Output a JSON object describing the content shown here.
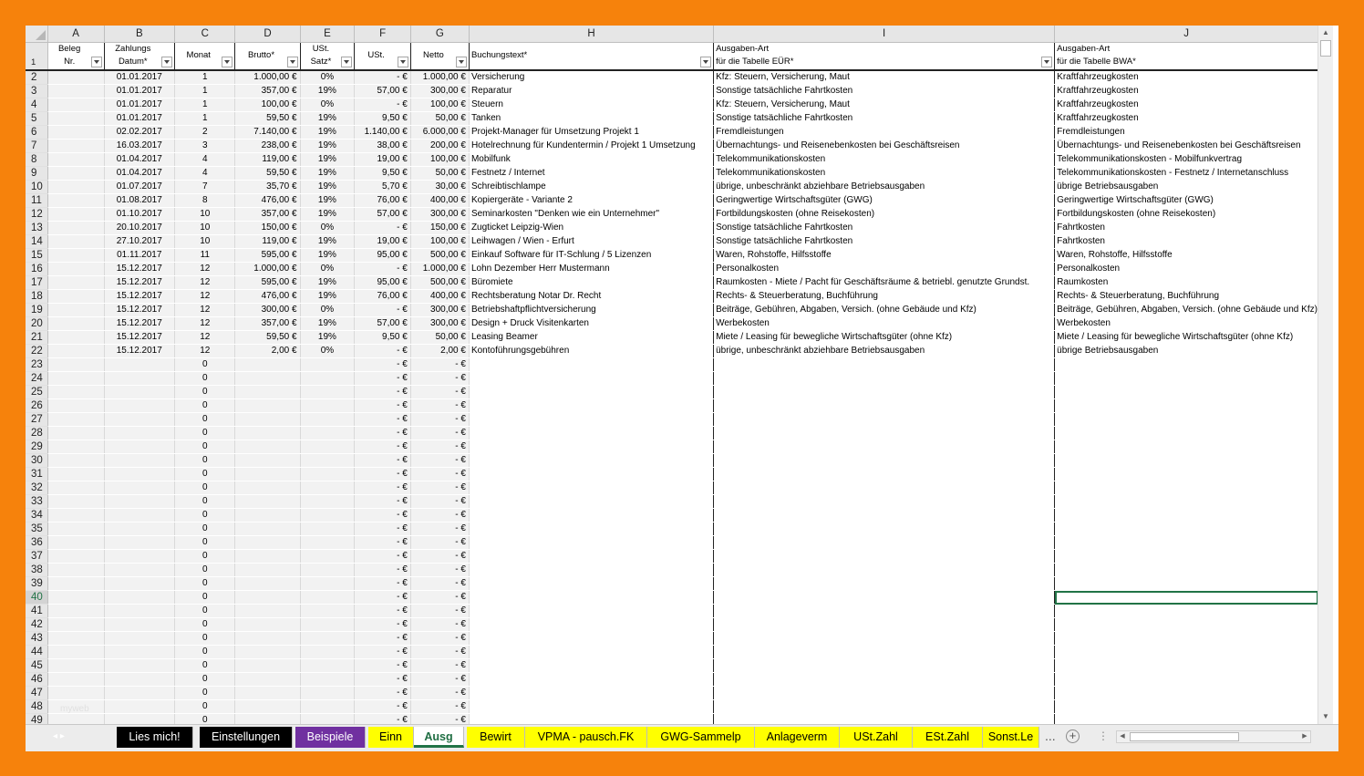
{
  "columns": [
    "A",
    "B",
    "C",
    "D",
    "E",
    "F",
    "G",
    "H",
    "I",
    "J"
  ],
  "headers": {
    "A": [
      "Beleg",
      "Nr."
    ],
    "B": [
      "Zahlungs",
      "Datum*"
    ],
    "C": [
      "Monat"
    ],
    "D": [
      "Brutto*"
    ],
    "E": [
      "USt.",
      "Satz*"
    ],
    "F": [
      "USt."
    ],
    "G": [
      "Netto"
    ],
    "H": [
      "Buchungstext*"
    ],
    "I": [
      "Ausgaben-Art",
      "für die Tabelle EÜR*"
    ],
    "J": [
      "Ausgaben-Art",
      "für die Tabelle BWA*"
    ]
  },
  "rows": [
    {
      "n": "2",
      "A": "",
      "B": "01.01.2017",
      "C": "1",
      "D": "1.000,00 €",
      "E": "0%",
      "F": "-   €",
      "G": "1.000,00 €",
      "H": "Versicherung",
      "I": "Kfz: Steuern, Versicherung, Maut",
      "J": "Kraftfahrzeugkosten"
    },
    {
      "n": "3",
      "A": "",
      "B": "01.01.2017",
      "C": "1",
      "D": "357,00 €",
      "E": "19%",
      "F": "57,00 €",
      "G": "300,00 €",
      "H": "Reparatur",
      "I": "Sonstige tatsächliche Fahrtkosten",
      "J": "Kraftfahrzeugkosten"
    },
    {
      "n": "4",
      "A": "",
      "B": "01.01.2017",
      "C": "1",
      "D": "100,00 €",
      "E": "0%",
      "F": "-   €",
      "G": "100,00 €",
      "H": "Steuern",
      "I": "Kfz: Steuern, Versicherung, Maut",
      "J": "Kraftfahrzeugkosten"
    },
    {
      "n": "5",
      "A": "",
      "B": "01.01.2017",
      "C": "1",
      "D": "59,50 €",
      "E": "19%",
      "F": "9,50 €",
      "G": "50,00 €",
      "H": "Tanken",
      "I": "Sonstige tatsächliche Fahrtkosten",
      "J": "Kraftfahrzeugkosten"
    },
    {
      "n": "6",
      "A": "",
      "B": "02.02.2017",
      "C": "2",
      "D": "7.140,00 €",
      "E": "19%",
      "F": "1.140,00 €",
      "G": "6.000,00 €",
      "H": "Projekt-Manager für Umsetzung Projekt 1",
      "I": "Fremdleistungen",
      "J": "Fremdleistungen"
    },
    {
      "n": "7",
      "A": "",
      "B": "16.03.2017",
      "C": "3",
      "D": "238,00 €",
      "E": "19%",
      "F": "38,00 €",
      "G": "200,00 €",
      "H": "Hotelrechnung für Kundentermin / Projekt 1 Umsetzung",
      "I": "Übernachtungs- und Reisenebenkosten bei Geschäftsreisen",
      "J": "Übernachtungs- und Reisenebenkosten bei Geschäftsreisen"
    },
    {
      "n": "8",
      "A": "",
      "B": "01.04.2017",
      "C": "4",
      "D": "119,00 €",
      "E": "19%",
      "F": "19,00 €",
      "G": "100,00 €",
      "H": "Mobilfunk",
      "I": "Telekommunikationskosten",
      "J": "Telekommunikationskosten - Mobilfunkvertrag"
    },
    {
      "n": "9",
      "A": "",
      "B": "01.04.2017",
      "C": "4",
      "D": "59,50 €",
      "E": "19%",
      "F": "9,50 €",
      "G": "50,00 €",
      "H": "Festnetz / Internet",
      "I": "Telekommunikationskosten",
      "J": "Telekommunikationskosten - Festnetz / Internetanschluss"
    },
    {
      "n": "10",
      "A": "",
      "B": "01.07.2017",
      "C": "7",
      "D": "35,70 €",
      "E": "19%",
      "F": "5,70 €",
      "G": "30,00 €",
      "H": "Schreibtischlampe",
      "I": "übrige, unbeschränkt abziehbare Betriebsausgaben",
      "J": "übrige Betriebsausgaben"
    },
    {
      "n": "11",
      "A": "",
      "B": "01.08.2017",
      "C": "8",
      "D": "476,00 €",
      "E": "19%",
      "F": "76,00 €",
      "G": "400,00 €",
      "H": "Kopiergeräte - Variante 2",
      "I": "Geringwertige Wirtschaftsgüter (GWG)",
      "J": "Geringwertige Wirtschaftsgüter (GWG)"
    },
    {
      "n": "12",
      "A": "",
      "B": "01.10.2017",
      "C": "10",
      "D": "357,00 €",
      "E": "19%",
      "F": "57,00 €",
      "G": "300,00 €",
      "H": "Seminarkosten \"Denken wie ein Unternehmer\"",
      "I": "Fortbildungskosten (ohne Reisekosten)",
      "J": "Fortbildungskosten (ohne Reisekosten)"
    },
    {
      "n": "13",
      "A": "",
      "B": "20.10.2017",
      "C": "10",
      "D": "150,00 €",
      "E": "0%",
      "F": "-   €",
      "G": "150,00 €",
      "H": "Zugticket Leipzig-Wien",
      "I": "Sonstige tatsächliche Fahrtkosten",
      "J": "Fahrtkosten"
    },
    {
      "n": "14",
      "A": "",
      "B": "27.10.2017",
      "C": "10",
      "D": "119,00 €",
      "E": "19%",
      "F": "19,00 €",
      "G": "100,00 €",
      "H": "Leihwagen / Wien - Erfurt",
      "I": "Sonstige tatsächliche Fahrtkosten",
      "J": "Fahrtkosten"
    },
    {
      "n": "15",
      "A": "",
      "B": "01.11.2017",
      "C": "11",
      "D": "595,00 €",
      "E": "19%",
      "F": "95,00 €",
      "G": "500,00 €",
      "H": "Einkauf Software für IT-Schlung / 5 Lizenzen",
      "I": "Waren, Rohstoffe, Hilfsstoffe",
      "J": "Waren, Rohstoffe, Hilfsstoffe"
    },
    {
      "n": "16",
      "A": "",
      "B": "15.12.2017",
      "C": "12",
      "D": "1.000,00 €",
      "E": "0%",
      "F": "-   €",
      "G": "1.000,00 €",
      "H": "Lohn Dezember Herr Mustermann",
      "I": "Personalkosten",
      "J": "Personalkosten"
    },
    {
      "n": "17",
      "A": "",
      "B": "15.12.2017",
      "C": "12",
      "D": "595,00 €",
      "E": "19%",
      "F": "95,00 €",
      "G": "500,00 €",
      "H": "Büromiete",
      "I": "Raumkosten - Miete / Pacht für Geschäftsräume & betriebl. genutzte Grundst.",
      "J": "Raumkosten"
    },
    {
      "n": "18",
      "A": "",
      "B": "15.12.2017",
      "C": "12",
      "D": "476,00 €",
      "E": "19%",
      "F": "76,00 €",
      "G": "400,00 €",
      "H": "Rechtsberatung Notar Dr. Recht",
      "I": "Rechts- & Steuerberatung, Buchführung",
      "J": "Rechts- & Steuerberatung, Buchführung"
    },
    {
      "n": "19",
      "A": "",
      "B": "15.12.2017",
      "C": "12",
      "D": "300,00 €",
      "E": "0%",
      "F": "-   €",
      "G": "300,00 €",
      "H": "Betriebshaftpflichtversicherung",
      "I": "Beiträge, Gebühren, Abgaben, Versich. (ohne Gebäude und Kfz)",
      "J": "Beiträge, Gebühren, Abgaben, Versich. (ohne Gebäude und Kfz)"
    },
    {
      "n": "20",
      "A": "",
      "B": "15.12.2017",
      "C": "12",
      "D": "357,00 €",
      "E": "19%",
      "F": "57,00 €",
      "G": "300,00 €",
      "H": "Design + Druck Visitenkarten",
      "I": "Werbekosten",
      "J": "Werbekosten"
    },
    {
      "n": "21",
      "A": "",
      "B": "15.12.2017",
      "C": "12",
      "D": "59,50 €",
      "E": "19%",
      "F": "9,50 €",
      "G": "50,00 €",
      "H": "Leasing Beamer",
      "I": "Miete / Leasing für bewegliche Wirtschaftsgüter (ohne Kfz)",
      "J": "Miete / Leasing für bewegliche Wirtschaftsgüter (ohne Kfz)"
    },
    {
      "n": "22",
      "A": "",
      "B": "15.12.2017",
      "C": "12",
      "D": "2,00 €",
      "E": "0%",
      "F": "-   €",
      "G": "2,00 €",
      "H": "Kontoführungsgebühren",
      "I": "übrige, unbeschränkt abziehbare Betriebsausgaben",
      "J": "übrige Betriebsausgaben"
    }
  ],
  "empty_rows": {
    "from": 23,
    "to": 49,
    "month": "0",
    "ust": "-   €",
    "netto": "-   €"
  },
  "active_row": "40",
  "tabs": [
    {
      "label": "Lies mich!",
      "bg": "#000000",
      "fg": "#ffffff"
    },
    {
      "label": "Einstellungen",
      "bg": "#000000",
      "fg": "#ffffff"
    },
    {
      "label": "Beispiele",
      "bg": "#7030a0",
      "fg": "#ffffff"
    },
    {
      "label": "Einn",
      "bg": "#ffff00",
      "fg": "#000000"
    },
    {
      "label": "Ausg",
      "bg": "#ffffff",
      "fg": "#1f6e43",
      "active": true
    },
    {
      "label": "Bewirt",
      "bg": "#ffff00",
      "fg": "#000000"
    },
    {
      "label": "VPMA - pausch.FK",
      "bg": "#ffff00",
      "fg": "#000000"
    },
    {
      "label": "GWG-Sammelp",
      "bg": "#ffff00",
      "fg": "#000000"
    },
    {
      "label": "Anlageverm",
      "bg": "#ffff00",
      "fg": "#000000"
    },
    {
      "label": "USt.Zahl",
      "bg": "#ffff00",
      "fg": "#000000"
    },
    {
      "label": "ESt.Zahl",
      "bg": "#ffff00",
      "fg": "#000000"
    },
    {
      "label": "Sonst.Le",
      "bg": "#ffff00",
      "fg": "#000000"
    }
  ],
  "tabbar": {
    "more_label": "...",
    "add_label": "+",
    "watermark": "myweb",
    "nav_prev": "◂",
    "nav_next": "▸"
  },
  "colors": {
    "frame": "#f6820c",
    "grid_gray": "#f2f2f2",
    "selection": "#217346"
  }
}
